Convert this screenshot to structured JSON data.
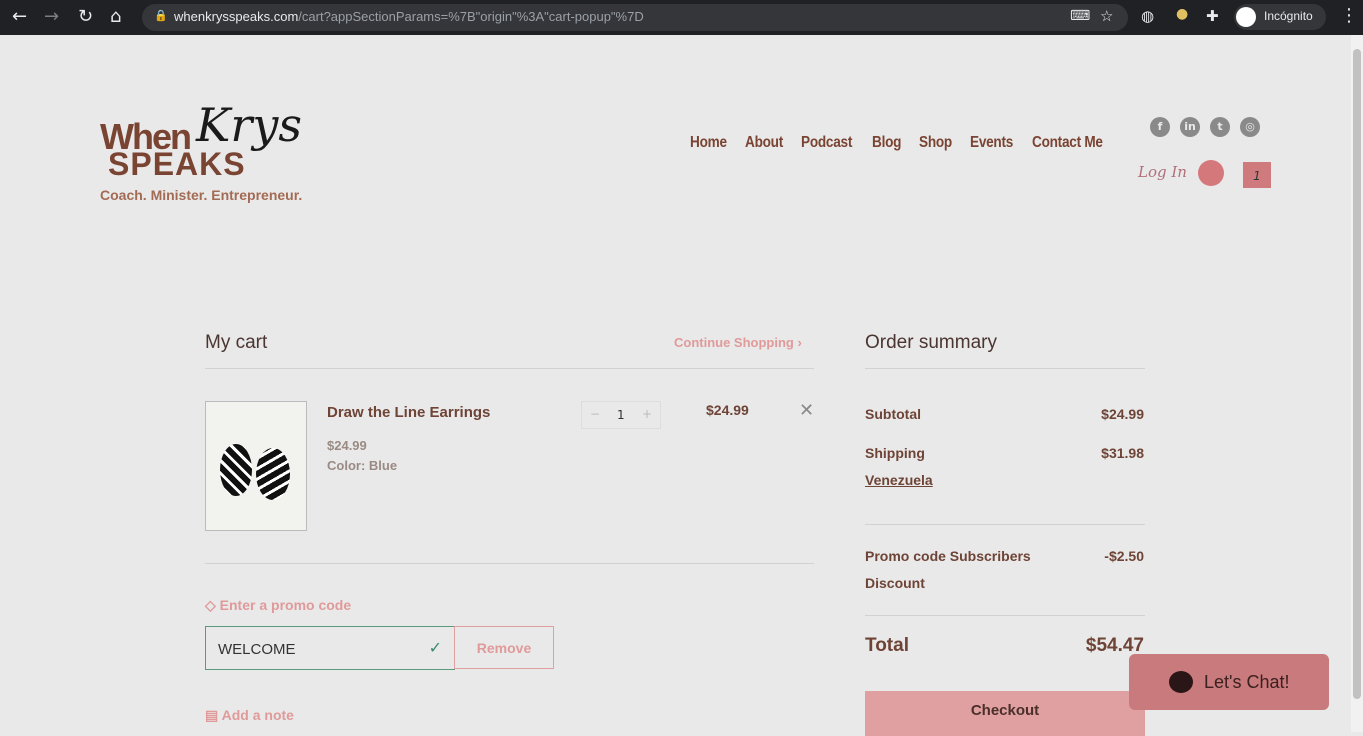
{
  "browser": {
    "url_domain": "whenkrysspeaks.com",
    "url_path": "/cart?appSectionParams=%7B\"origin\"%3A\"cart-popup\"%7D",
    "profile": "Incógnito"
  },
  "logo": {
    "text": "When Krys SPEAKS",
    "tagline": "Coach. Minister. Entrepreneur."
  },
  "nav": [
    "Home",
    "About",
    "Podcast",
    "Blog",
    "Shop",
    "Events",
    "Contact Me"
  ],
  "social": [
    "facebook-icon",
    "linkedin-icon",
    "twitter-icon",
    "instagram-icon"
  ],
  "header": {
    "login": "Log In",
    "cart_count": "1"
  },
  "cart": {
    "title": "My cart",
    "continue": "Continue Shopping",
    "item": {
      "name": "Draw the Line Earrings",
      "unit_price": "$24.99",
      "color": "Color: Blue",
      "qty": "1",
      "total": "$24.99"
    },
    "promo_label": "Enter a promo code",
    "promo_value": "WELCOME",
    "remove": "Remove",
    "note": "Add a note"
  },
  "summary": {
    "title": "Order summary",
    "subtotal_label": "Subtotal",
    "subtotal": "$24.99",
    "shipping_label": "Shipping",
    "shipping": "$31.98",
    "country": "Venezuela",
    "promo_label_1": "Promo code Subscribers",
    "promo_label_2": "Discount",
    "promo": "-$2.50",
    "total_label": "Total",
    "total": "$54.47",
    "checkout": "Checkout"
  },
  "chat": {
    "label": "Let's Chat!"
  },
  "colors": {
    "brand": "#7a4433",
    "accent": "#e09a9a",
    "chat": "#c97a7c"
  }
}
